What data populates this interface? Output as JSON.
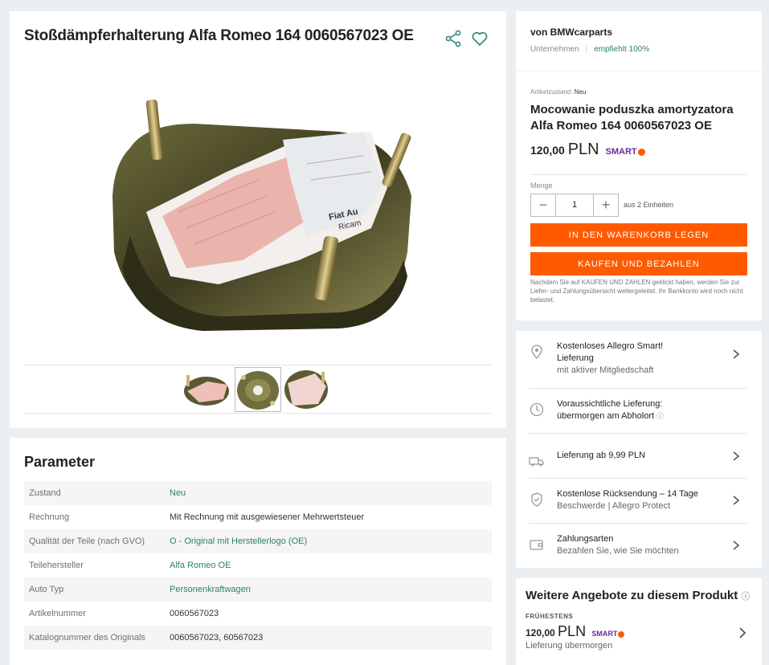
{
  "gallery": {
    "title": "Stoßdämpferhalterung Alfa Romeo 164 0060567023 OE",
    "share_icon": "share-icon",
    "favorite_icon": "heart-icon",
    "image_label_1": "Fiat Au",
    "image_label_2": "Ricam"
  },
  "parameters": {
    "title": "Parameter",
    "rows": [
      {
        "key": "Zustand",
        "value": "Neu"
      },
      {
        "key": "Rechnung",
        "value": "Mit Rechnung mit ausgewiesener Mehrwertsteuer"
      },
      {
        "key": "Qualität der Teile (nach GVO)",
        "value": "O - Original mit Herstellerlogo (OE)"
      },
      {
        "key": "Teilehersteller",
        "value": "Alfa Romeo OE"
      },
      {
        "key": "Auto Typ",
        "value": "Personenkraftwagen"
      },
      {
        "key": "Artikelnummer",
        "value": "0060567023"
      },
      {
        "key": "Katalognummer des Originals",
        "value": "0060567023, 60567023"
      }
    ]
  },
  "seller": {
    "name": "von BMWcarparts",
    "type": "Unternehmen",
    "rating": "empfiehlt 100%"
  },
  "buybox": {
    "condition_label": "Artikelzustand:",
    "condition_value": "Neu",
    "product_title": "Mocowanie poduszka amortyzatora Alfa Romeo 164 0060567023 OE",
    "price_main": "120,00",
    "price_currency": "PLN",
    "smart_label": "SMART",
    "quantity_label": "Menge",
    "quantity_value": "1",
    "minus": "−",
    "plus": "+",
    "availability": "aus 2 Einheiten",
    "add_to_cart": "IN DEN WARENKORB LEGEN",
    "buy_now": "KAUFEN UND BEZAHLEN",
    "note": "Nachdem Sie auf KAUFEN UND ZAHLEN geklickt haben, werden Sie zur Liefer- und Zahlungsübersicht weitergeleitet. Ihr Bankkonto wird noch nicht belastet."
  },
  "delivery": {
    "items": [
      {
        "icon": "map-pin-icon",
        "line1": "Kostenloses Allegro Smart!",
        "line2": "Lieferung",
        "sub": "mit aktiver Mitgliedschaft"
      },
      {
        "icon": "clock-icon",
        "line1": "Voraussichtliche Lieferung:",
        "line2": "übermorgen am Abholort",
        "info": "ⓘ"
      },
      {
        "icon": "truck-icon",
        "line1": "Lieferung ab 9,99 PLN"
      },
      {
        "icon": "shield-icon",
        "line1": "Kostenlose Rücksendung – 14 Tage",
        "sub": "Beschwerde | Allegro Protect"
      },
      {
        "icon": "wallet-icon",
        "line1": "Zahlungsarten",
        "sub": "Bezahlen Sie, wie Sie möchten"
      }
    ]
  },
  "offers": {
    "title": "Weitere Angebote zu diesem Produkt",
    "info": "ⓘ",
    "earliest_label": "FRÜHESTENS",
    "price_main": "120,00",
    "price_currency": "PLN",
    "smart_label": "SMART",
    "delivery": "Lieferung übermorgen"
  },
  "colors": {
    "accent": "#ff5a00",
    "link": "#2f7f72",
    "smart": "#6a2b9c"
  }
}
